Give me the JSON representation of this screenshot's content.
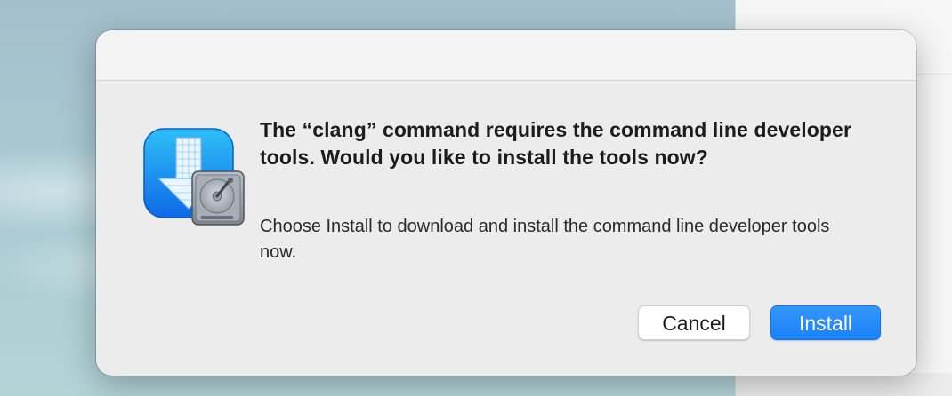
{
  "dialog": {
    "headline": "The “clang” command requires the command line developer tools. Would you like to install the tools now?",
    "message": "Choose Install to download and install the command line developer tools now.",
    "icon": "install-developer-tools-icon",
    "buttons": {
      "cancel_label": "Cancel",
      "install_label": "Install"
    }
  },
  "colors": {
    "accent": "#1a82fa",
    "dialog_background": "#ececec"
  }
}
